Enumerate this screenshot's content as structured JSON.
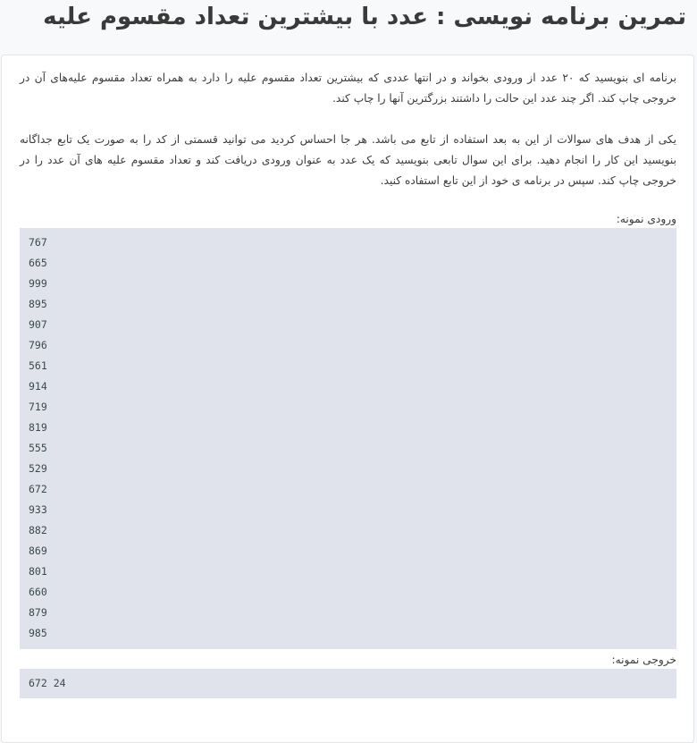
{
  "page": {
    "title": "تمرین برنامه نویسی : عدد با بیشترین تعداد مقسوم علیه"
  },
  "content": {
    "paragraph_1": "برنامه ای بنویسید که ۲۰ عدد از ورودی بخواند و در انتها عددی که بیشترین تعداد مقسوم علیه را دارد به همراه تعداد مقسوم علیه‌های آن در خروجی چاپ کند. اگر چند عدد این حالت را داشتند بزرگترین آنها را چاپ کند.",
    "paragraph_2": "یکی از هدف های سوالات از این به بعد استفاده از تابع می باشد. هر جا احساس کردید می توانید قسمتی از کد را به صورت یک تابع جداگانه بنویسید این کار را انجام دهید. برای این سوال تابعی بنویسید که یک عدد به عنوان ورودی دریافت کند و تعداد مقسوم علیه های آن عدد را در خروجی چاپ کند. سپس در برنامه ی خود از این تابع استفاده کنید."
  },
  "sample_input": {
    "label": "ورودی نمونه:",
    "lines": [
      "767",
      "665",
      "999",
      "895",
      "907",
      "796",
      "561",
      "914",
      "719",
      "819",
      "555",
      "529",
      "672",
      "933",
      "882",
      "869",
      "801",
      "660",
      "879",
      "985"
    ]
  },
  "sample_output": {
    "label": "خروجی نمونه:",
    "lines": [
      "672 24"
    ]
  }
}
